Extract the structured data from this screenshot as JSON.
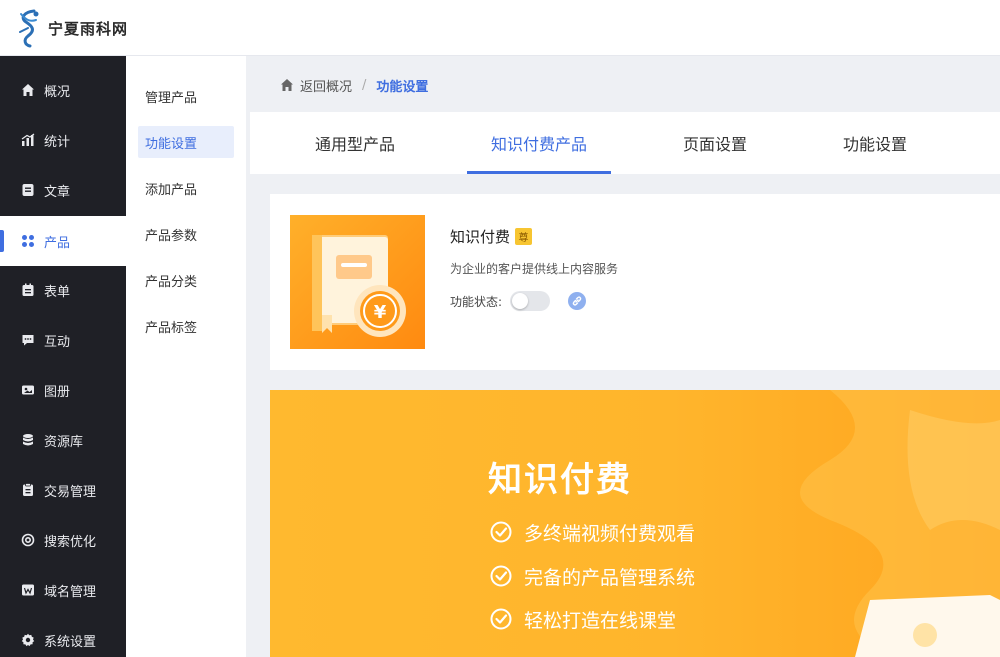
{
  "header": {
    "logo_text": "宁夏雨科网"
  },
  "sidebar": {
    "items": [
      {
        "label": "概况",
        "icon": "home-icon"
      },
      {
        "label": "统计",
        "icon": "chart-icon"
      },
      {
        "label": "文章",
        "icon": "article-icon"
      },
      {
        "label": "产品",
        "icon": "grid-icon"
      },
      {
        "label": "表单",
        "icon": "form-icon"
      },
      {
        "label": "互动",
        "icon": "chat-icon"
      },
      {
        "label": "图册",
        "icon": "image-icon"
      },
      {
        "label": "资源库",
        "icon": "database-icon"
      },
      {
        "label": "交易管理",
        "icon": "trade-icon"
      },
      {
        "label": "搜索优化",
        "icon": "seo-icon"
      },
      {
        "label": "域名管理",
        "icon": "domain-icon"
      },
      {
        "label": "系统设置",
        "icon": "gear-icon"
      }
    ],
    "active": "产品"
  },
  "subnav": {
    "items": [
      {
        "label": "管理产品"
      },
      {
        "label": "功能设置"
      },
      {
        "label": "添加产品"
      },
      {
        "label": "产品参数"
      },
      {
        "label": "产品分类"
      },
      {
        "label": "产品标签"
      }
    ],
    "active": "功能设置"
  },
  "breadcrumb": {
    "back": "返回概况",
    "sep": "/",
    "current": "功能设置"
  },
  "tabs": [
    {
      "label": "通用型产品"
    },
    {
      "label": "知识付费产品"
    },
    {
      "label": "页面设置"
    },
    {
      "label": "功能设置"
    }
  ],
  "active_tab": "知识付费产品",
  "card": {
    "title": "知识付费",
    "badge": "尊",
    "description": "为企业的客户提供线上内容服务",
    "status_label": "功能状态:",
    "status_on": false
  },
  "banner": {
    "title": "知识付费",
    "features": [
      {
        "label": "多终端视频付费观看"
      },
      {
        "label": "完备的产品管理系统"
      },
      {
        "label": "轻松打造在线课堂"
      }
    ]
  },
  "colors": {
    "accent": "#3f6ee0",
    "sidebar_bg": "#1f2026",
    "banner": "#ffb52c",
    "thumb": "#ff9a1a"
  }
}
